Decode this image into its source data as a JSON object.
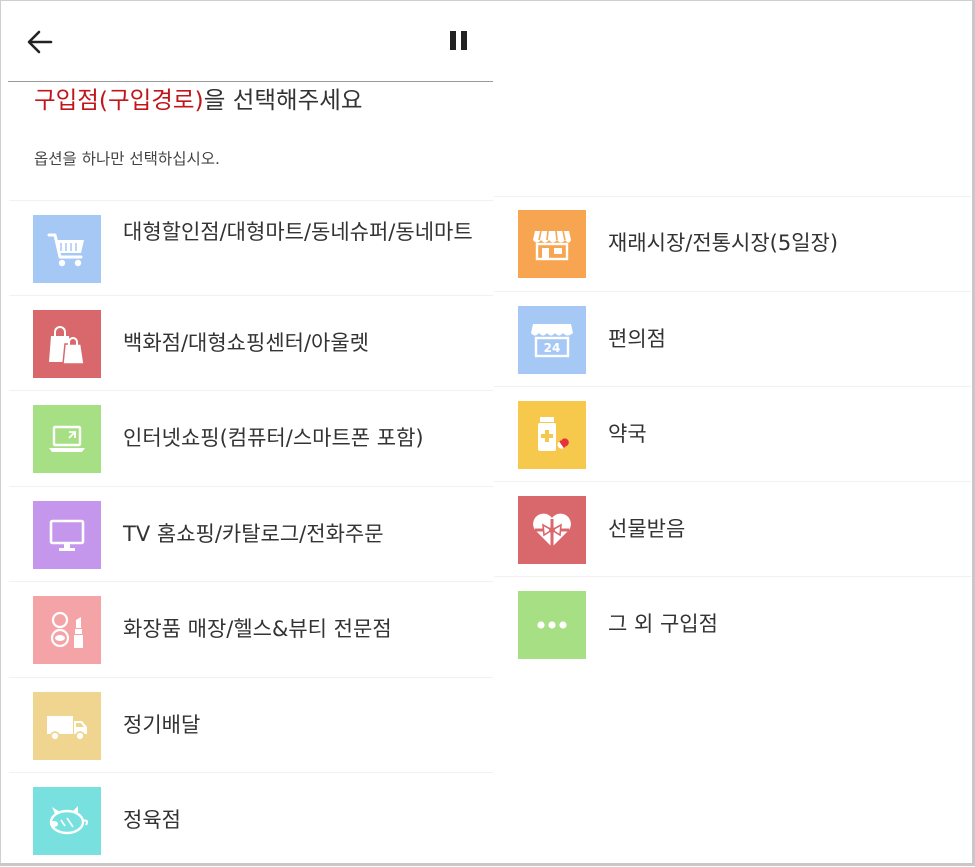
{
  "header": {
    "back_icon": "arrow-left-icon",
    "pause_icon": "pause-icon"
  },
  "question": {
    "title_highlight": "구입점(구입경로)",
    "title_rest": "을 선택해주세요",
    "instruction": "옵션을 하나만 선택하십시오."
  },
  "options_left": [
    {
      "label": "대형할인점/대형마트/동네슈퍼/동네마트",
      "icon": "shopping-cart-icon",
      "color": "#a6c8f5"
    },
    {
      "label": "백화점/대형쇼핑센터/아울렛",
      "icon": "shopping-bags-icon",
      "color": "#d9686c"
    },
    {
      "label": "인터넷쇼핑(컴퓨터/스마트폰 포함)",
      "icon": "laptop-icon",
      "color": "#a6df84"
    },
    {
      "label": "TV 홈쇼핑/카탈로그/전화주문",
      "icon": "monitor-icon",
      "color": "#c497ec"
    },
    {
      "label": "화장품 매장/헬스&뷰티 전문점",
      "icon": "cosmetics-icon",
      "color": "#f4a4a6"
    },
    {
      "label": "정기배달",
      "icon": "delivery-truck-icon",
      "color": "#f0d591"
    },
    {
      "label": "정육점",
      "icon": "pig-icon",
      "color": "#79e0e0"
    }
  ],
  "options_right": [
    {
      "label": "재래시장/전통시장(5일장)",
      "icon": "market-stall-icon",
      "color": "#f8a552"
    },
    {
      "label": "편의점",
      "icon": "convenience-store-24-icon",
      "color": "#a6c8f5",
      "badge": "24"
    },
    {
      "label": "약국",
      "icon": "pharmacy-icon",
      "color": "#f6c84b"
    },
    {
      "label": "선물받음",
      "icon": "gift-heart-icon",
      "color": "#d9686c"
    },
    {
      "label": "그 외 구입점",
      "icon": "more-dots-icon",
      "color": "#a6df84"
    }
  ]
}
